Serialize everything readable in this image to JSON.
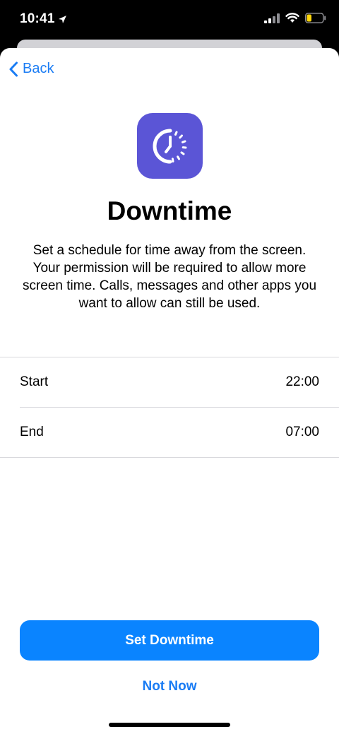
{
  "status_bar": {
    "time": "10:41",
    "location_icon": "location-arrow-icon",
    "signal_icon": "cellular-signal-icon",
    "wifi_icon": "wifi-icon",
    "battery_icon": "battery-icon",
    "battery_level": 0.3,
    "battery_color": "#ffd60a"
  },
  "nav": {
    "back_label": "Back",
    "back_icon": "chevron-left-icon"
  },
  "hero": {
    "icon": "downtime-clock-icon",
    "icon_color": "#5b55d6",
    "title": "Downtime",
    "description": "Set a schedule for time away from the screen. Your permission will be required to allow more screen time. Calls, messages and other apps you want to allow can still be used."
  },
  "schedule": {
    "rows": [
      {
        "label": "Start",
        "value": "22:00"
      },
      {
        "label": "End",
        "value": "07:00"
      }
    ]
  },
  "actions": {
    "primary_label": "Set Downtime",
    "secondary_label": "Not Now",
    "accent_color": "#0a84ff"
  }
}
